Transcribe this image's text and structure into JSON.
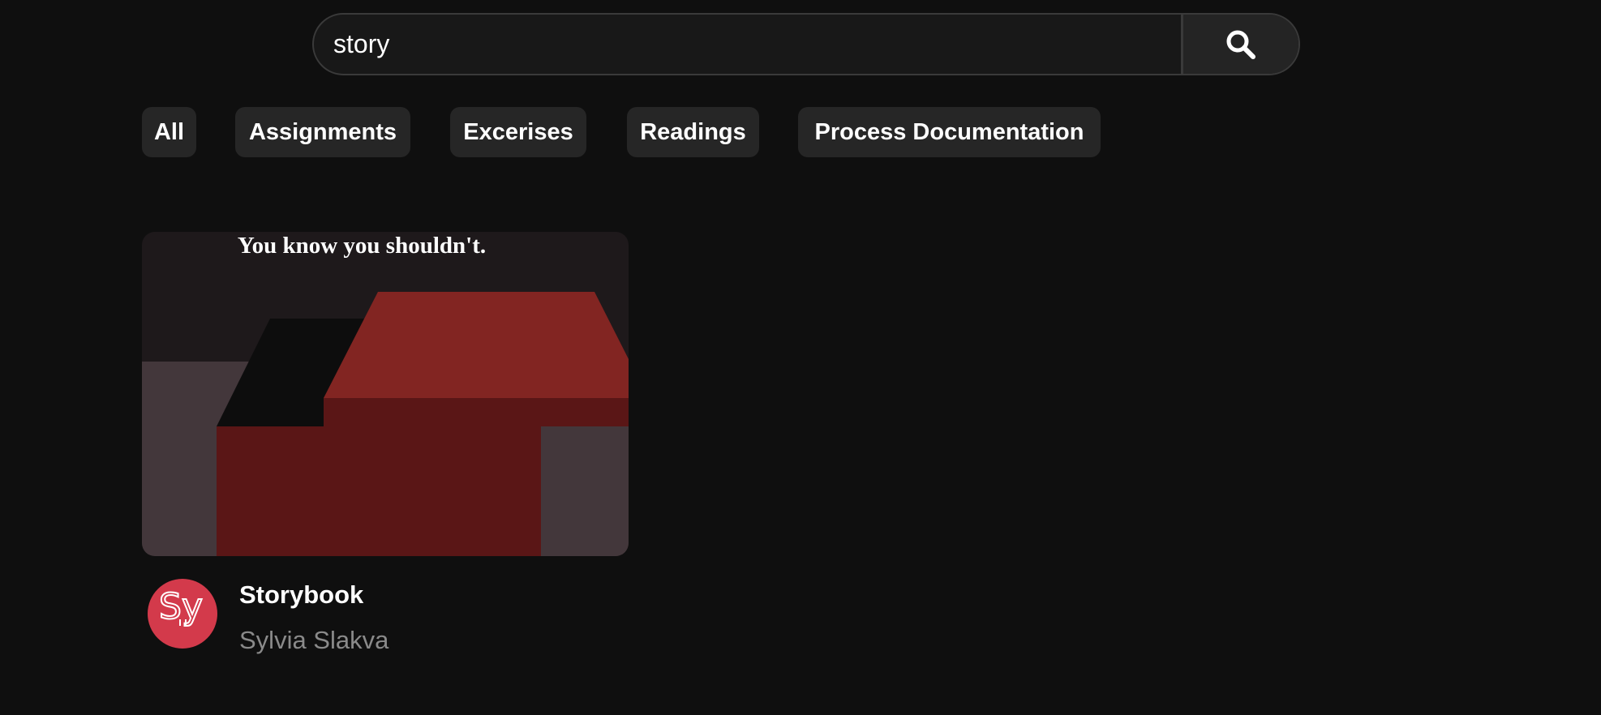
{
  "search": {
    "value": "story",
    "icon": "search-icon"
  },
  "filters": [
    {
      "label": "All"
    },
    {
      "label": "Assignments"
    },
    {
      "label": "Excerises"
    },
    {
      "label": "Readings"
    },
    {
      "label": "Process Documentation"
    }
  ],
  "results": [
    {
      "thumbnail_caption": "You know you shouldn't.",
      "title": "Storybook",
      "author": "Sylvia Slakva",
      "avatar_color": "#d33a4b",
      "avatar_text": "Sy"
    }
  ],
  "colors": {
    "background": "#0f0f0f",
    "chip": "#262626",
    "accent": "#d33a4b",
    "thumb_red": "#822522",
    "thumb_dark_red": "#5a1616"
  }
}
